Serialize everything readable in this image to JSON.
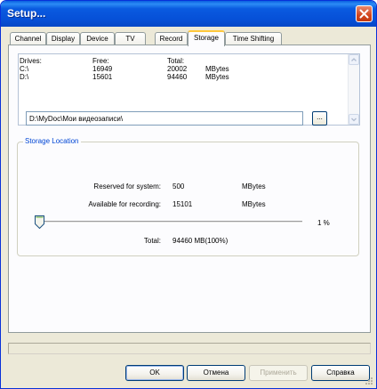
{
  "window": {
    "title": "Setup..."
  },
  "tabs": [
    {
      "label": "Channel"
    },
    {
      "label": "Display"
    },
    {
      "label": "Device"
    },
    {
      "label": "TV"
    },
    {
      "label": "Record"
    },
    {
      "label": "Storage"
    },
    {
      "label": "Time Shifting"
    }
  ],
  "active_tab": "Storage",
  "drives": {
    "headers": {
      "drive": "Drives:",
      "free": "Free:",
      "total": "Total:"
    },
    "rows": [
      {
        "drive": "C:\\",
        "free": "16949",
        "total": "20002",
        "unit": "MBytes"
      },
      {
        "drive": "D:\\",
        "free": "15601",
        "total": "94460",
        "unit": "MBytes"
      }
    ]
  },
  "storage": {
    "group_title": "Storage Location",
    "path": "D:\\MyDoc\\Мои видеозаписи\\",
    "browse_label": "...",
    "reserved_label": "Reserved for system:",
    "reserved_value": "500",
    "reserved_unit": "MBytes",
    "available_label": "Available for recording:",
    "available_value": "15101",
    "available_unit": "MBytes",
    "slider_value_pct": 1,
    "slider_display": "1 %",
    "total_label": "Total:",
    "total_value": "94460 MB(100%)"
  },
  "buttons": {
    "ok": "OK",
    "cancel": "Отмена",
    "apply": "Применить",
    "help": "Справка"
  }
}
